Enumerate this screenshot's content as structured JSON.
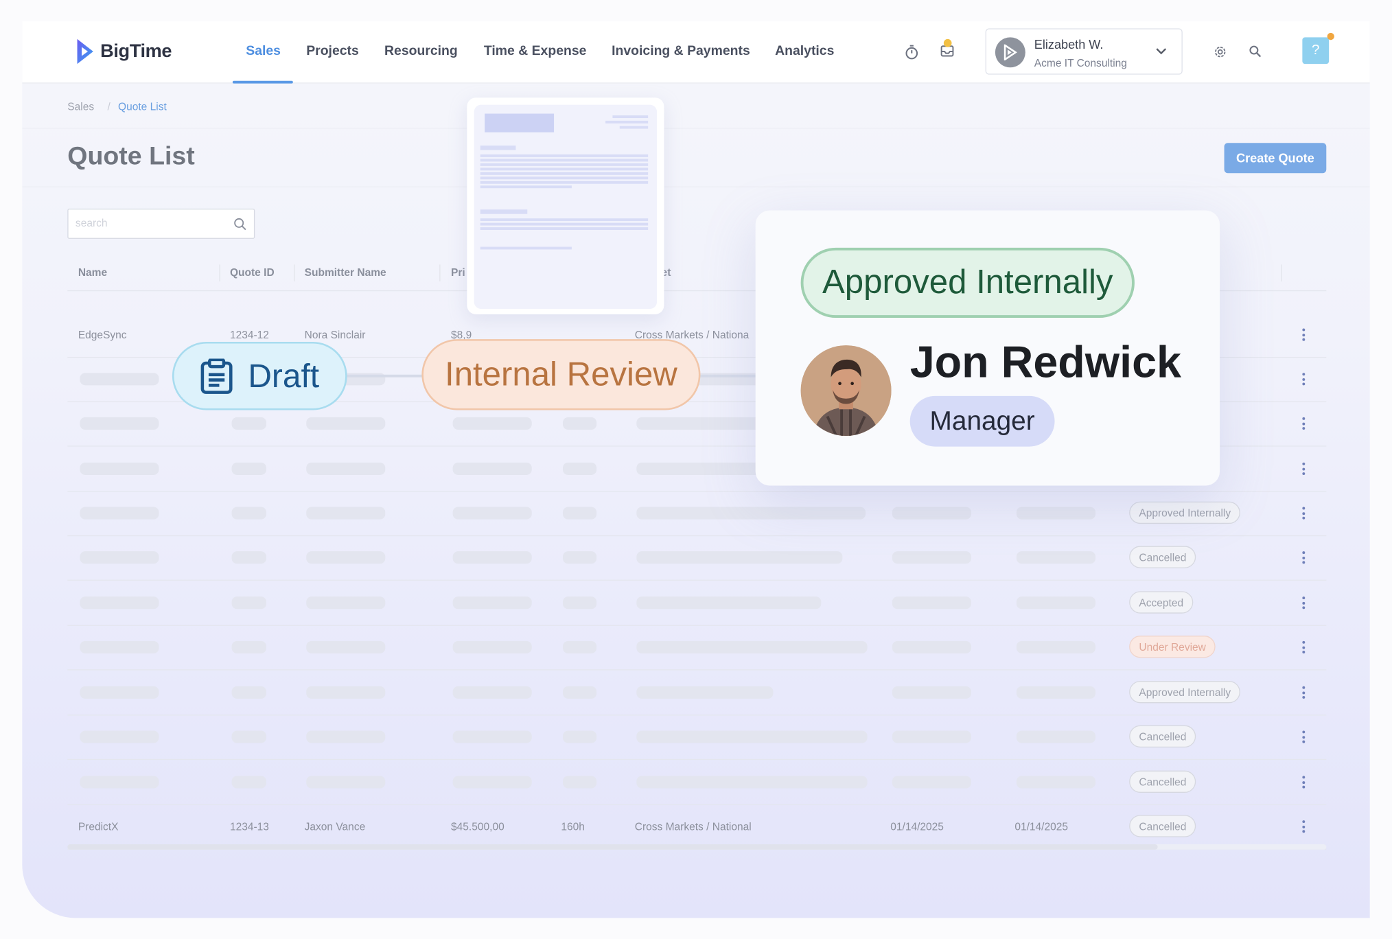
{
  "app": {
    "brand": "BigTime"
  },
  "nav": [
    {
      "label": "Sales",
      "active": true
    },
    {
      "label": "Projects"
    },
    {
      "label": "Resourcing"
    },
    {
      "label": "Time & Expense"
    },
    {
      "label": "Invoicing & Payments"
    },
    {
      "label": "Analytics"
    }
  ],
  "header_icons": [
    "stopwatch-icon",
    "inbox-icon",
    "gear-icon",
    "search-icon",
    "help-icon"
  ],
  "user": {
    "name": "Elizabeth W.",
    "org": "Acme IT Consulting"
  },
  "help": {
    "label": "?"
  },
  "breadcrumb": {
    "parent": "Sales",
    "current": "Quote List"
  },
  "page": {
    "title": "Quote List",
    "create_button": "Create Quote"
  },
  "search": {
    "placeholder": "search"
  },
  "table": {
    "headers": [
      "Name",
      "Quote ID",
      "Submitter Name",
      "Pri",
      "et"
    ],
    "rows": [
      {
        "name": "EdgeSync",
        "quote_id": "1234-12",
        "submitter": "Nora Sinclair",
        "price": "$8,9",
        "market": "Cross Markets / Nationa"
      },
      {
        "status": ""
      },
      {
        "status": ""
      },
      {
        "status": ""
      },
      {
        "status": "Approved Internally"
      },
      {
        "status": "Cancelled"
      },
      {
        "status": "Accepted"
      },
      {
        "status": "Under Review"
      },
      {
        "status": "Approved Internally"
      },
      {
        "status": "Cancelled"
      },
      {
        "status": "Cancelled"
      },
      {
        "name": "PredictX",
        "quote_id": "1234-13",
        "submitter": "Jaxon Vance",
        "price": "$45.500,00",
        "hours": "160h",
        "market": "Cross Markets / National",
        "date1": "01/14/2025",
        "date2": "01/14/2025",
        "status": "Cancelled"
      }
    ]
  },
  "workflow": {
    "draft": "Draft",
    "review": "Internal Review",
    "approved": "Approved Internally"
  },
  "approver": {
    "name": "Jon Redwick",
    "role": "Manager"
  },
  "colors": {
    "accent": "#4d8ee0",
    "draft": "#1b568c",
    "review": "#b87440",
    "approved": "#1e5a3a",
    "role_bg": "#d6dbf8"
  }
}
